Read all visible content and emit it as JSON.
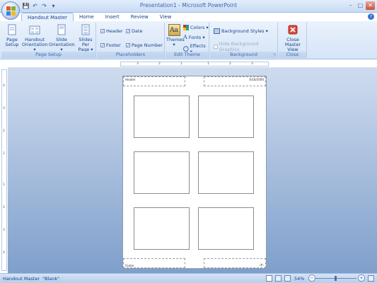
{
  "window": {
    "title": "Presentation1 - Microsoft PowerPoint",
    "minimize": "–",
    "maximize": "□",
    "close": "✕"
  },
  "qat": {
    "save": "💾",
    "undo": "↶",
    "redo": "↷",
    "customize": "▾"
  },
  "tabs": [
    "Handout Master",
    "Home",
    "Insert",
    "Review",
    "View"
  ],
  "help": "?",
  "ribbon": {
    "page_setup": {
      "label": "Page Setup",
      "page_setup": "Page\nSetup",
      "handout_orientation": "Handout\nOrientation ▾",
      "slide_orientation": "Slide\nOrientation ▾",
      "slides_per_page": "Slides Per\nPage ▾"
    },
    "placeholders": {
      "label": "Placeholders",
      "header": "Header",
      "date": "Date",
      "footer": "Footer",
      "page_number": "Page Number"
    },
    "edit_theme": {
      "label": "Edit Theme",
      "themes": "Themes\n▾",
      "themes_glyph": "Aa",
      "colors": "Colors ▾",
      "fonts": "Fonts ▾",
      "effects": "Effects ▾"
    },
    "background": {
      "label": "Background",
      "background_styles": "Background Styles ▾",
      "hide_background_graphics": "Hide Background Graphics"
    },
    "close": {
      "label": "Close",
      "close_master_view": "Close\nMaster View"
    }
  },
  "ruler": {
    "h_labels": [
      "3",
      "2",
      "1",
      "1",
      "2",
      "3"
    ],
    "v_labels": [
      "4",
      "3",
      "2",
      "1",
      "1",
      "2",
      "3",
      "4"
    ]
  },
  "page": {
    "header_text": "Header",
    "date_text": "6/18/2006",
    "footer_text": "Footer",
    "page_number_text": "‹#›"
  },
  "status": {
    "view": "Handout Master",
    "theme": "\"Blank\"",
    "zoom": "54%",
    "zoom_out": "−",
    "zoom_in": "+"
  }
}
